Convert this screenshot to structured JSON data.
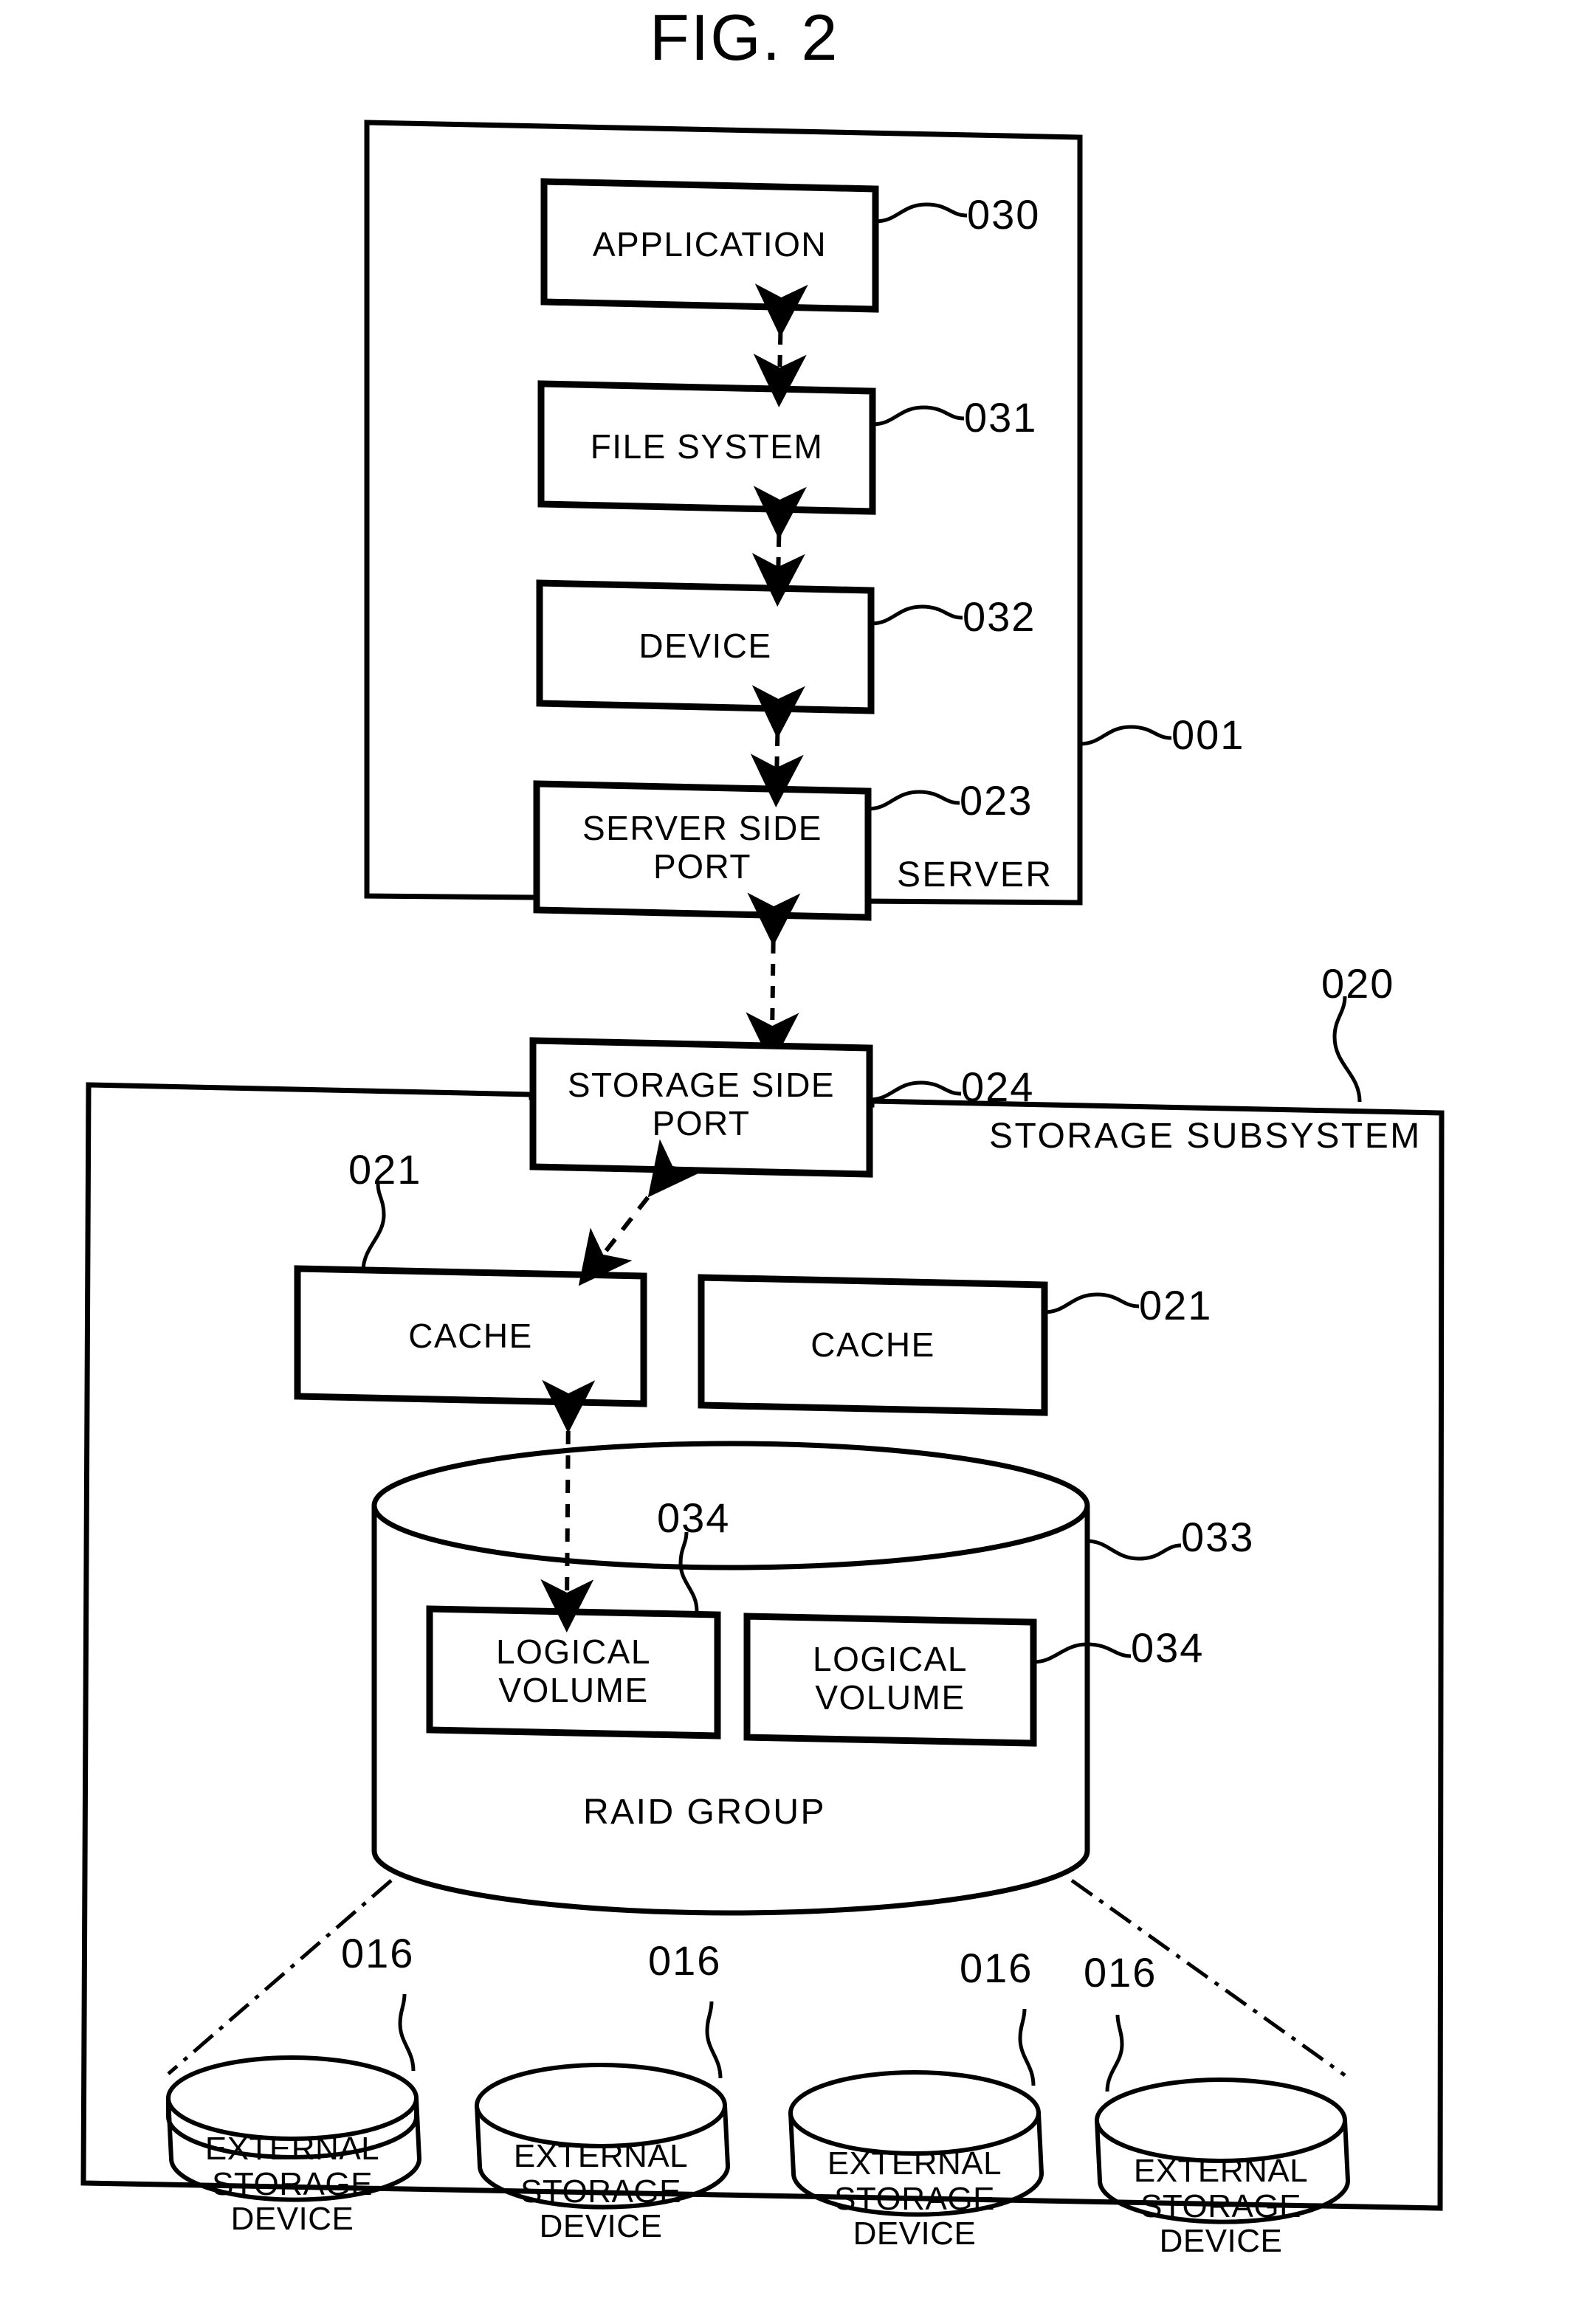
{
  "figure": {
    "title": "FIG. 2",
    "kind": "patent-block-diagram"
  },
  "colors": {
    "ink": "#000000",
    "paper": "#ffffff"
  },
  "server": {
    "container_label": "SERVER",
    "container_ref": "001",
    "blocks": [
      {
        "label": "APPLICATION",
        "ref": "030"
      },
      {
        "label": "FILE  SYSTEM",
        "ref": "031"
      },
      {
        "label": "DEVICE",
        "ref": "032"
      },
      {
        "label": "SERVER  SIDE\nPORT",
        "ref": "023"
      }
    ]
  },
  "storage": {
    "container_label": "STORAGE  SUBSYSTEM",
    "container_ref": "020",
    "port": {
      "label": "STORAGE  SIDE\nPORT",
      "ref": "024"
    },
    "caches": [
      {
        "label": "CACHE",
        "ref": "021"
      },
      {
        "label": "CACHE",
        "ref": "021"
      }
    ],
    "raid_group": {
      "label": "RAID  GROUP",
      "ref": "033",
      "logical_volumes": [
        {
          "label": "LOGICAL\nVOLUME",
          "ref": "034"
        },
        {
          "label": "LOGICAL\nVOLUME",
          "ref": "034"
        }
      ]
    },
    "external_devices": [
      {
        "label": "EXTERNAL\nSTORAGE\nDEVICE",
        "ref": "016"
      },
      {
        "label": "EXTERNAL\nSTORAGE\nDEVICE",
        "ref": "016"
      },
      {
        "label": "EXTERNAL\nSTORAGE\nDEVICE",
        "ref": "016"
      },
      {
        "label": "EXTERNAL\nSTORAGE\nDEVICE",
        "ref": "016"
      }
    ]
  },
  "connections": [
    {
      "from": "APPLICATION",
      "to": "FILE  SYSTEM",
      "style": "dashed-double-arrow"
    },
    {
      "from": "FILE  SYSTEM",
      "to": "DEVICE",
      "style": "dashed-double-arrow"
    },
    {
      "from": "DEVICE",
      "to": "SERVER  SIDE PORT",
      "style": "dashed-double-arrow"
    },
    {
      "from": "SERVER  SIDE PORT",
      "to": "STORAGE  SIDE PORT",
      "style": "dashed-double-arrow"
    },
    {
      "from": "STORAGE  SIDE PORT",
      "to": "CACHE",
      "style": "dashed-double-arrow"
    },
    {
      "from": "CACHE",
      "to": "LOGICAL VOLUME",
      "style": "dashed-double-arrow"
    },
    {
      "from": "RAID  GROUP",
      "to": "EXTERNAL STORAGE DEVICE",
      "style": "dash-dot-line"
    }
  ]
}
